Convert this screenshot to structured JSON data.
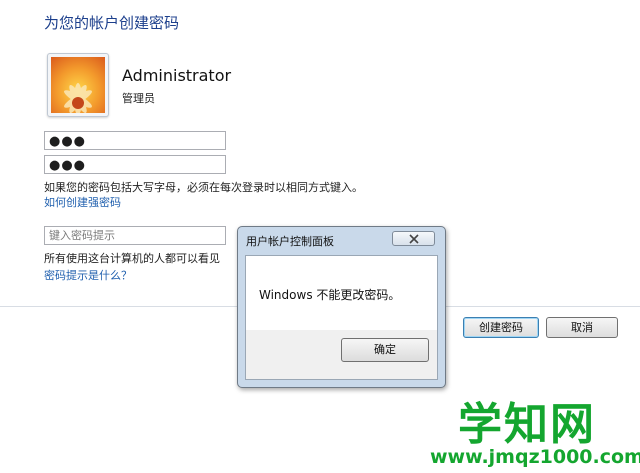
{
  "page": {
    "title": "为您的帐户创建密码"
  },
  "user": {
    "name": "Administrator",
    "role": "管理员"
  },
  "form": {
    "password_value": "●●●",
    "confirm_value": "●●●",
    "caps_note": "如果您的密码包括大写字母，必须在每次登录时以相同方式键入。",
    "strong_link": "如何创建强密码",
    "hint_placeholder": "键入密码提示",
    "hint_warning": "所有使用这台计算机的人都可以看见",
    "hint_link": "密码提示是什么？"
  },
  "buttons": {
    "create": "创建密码",
    "cancel": "取消"
  },
  "dialog": {
    "title": "用户帐户控制面板",
    "message": "Windows 不能更改密码。",
    "ok": "确定",
    "close_icon": "close-icon"
  },
  "watermark": {
    "brand": "学知网",
    "url": "www.jmqz1000.com"
  },
  "colors": {
    "title_blue": "#1c3f8c",
    "link_blue": "#1f5fae",
    "watermark_green": "#14a62f",
    "dialog_frame": "#c9d9ea"
  }
}
